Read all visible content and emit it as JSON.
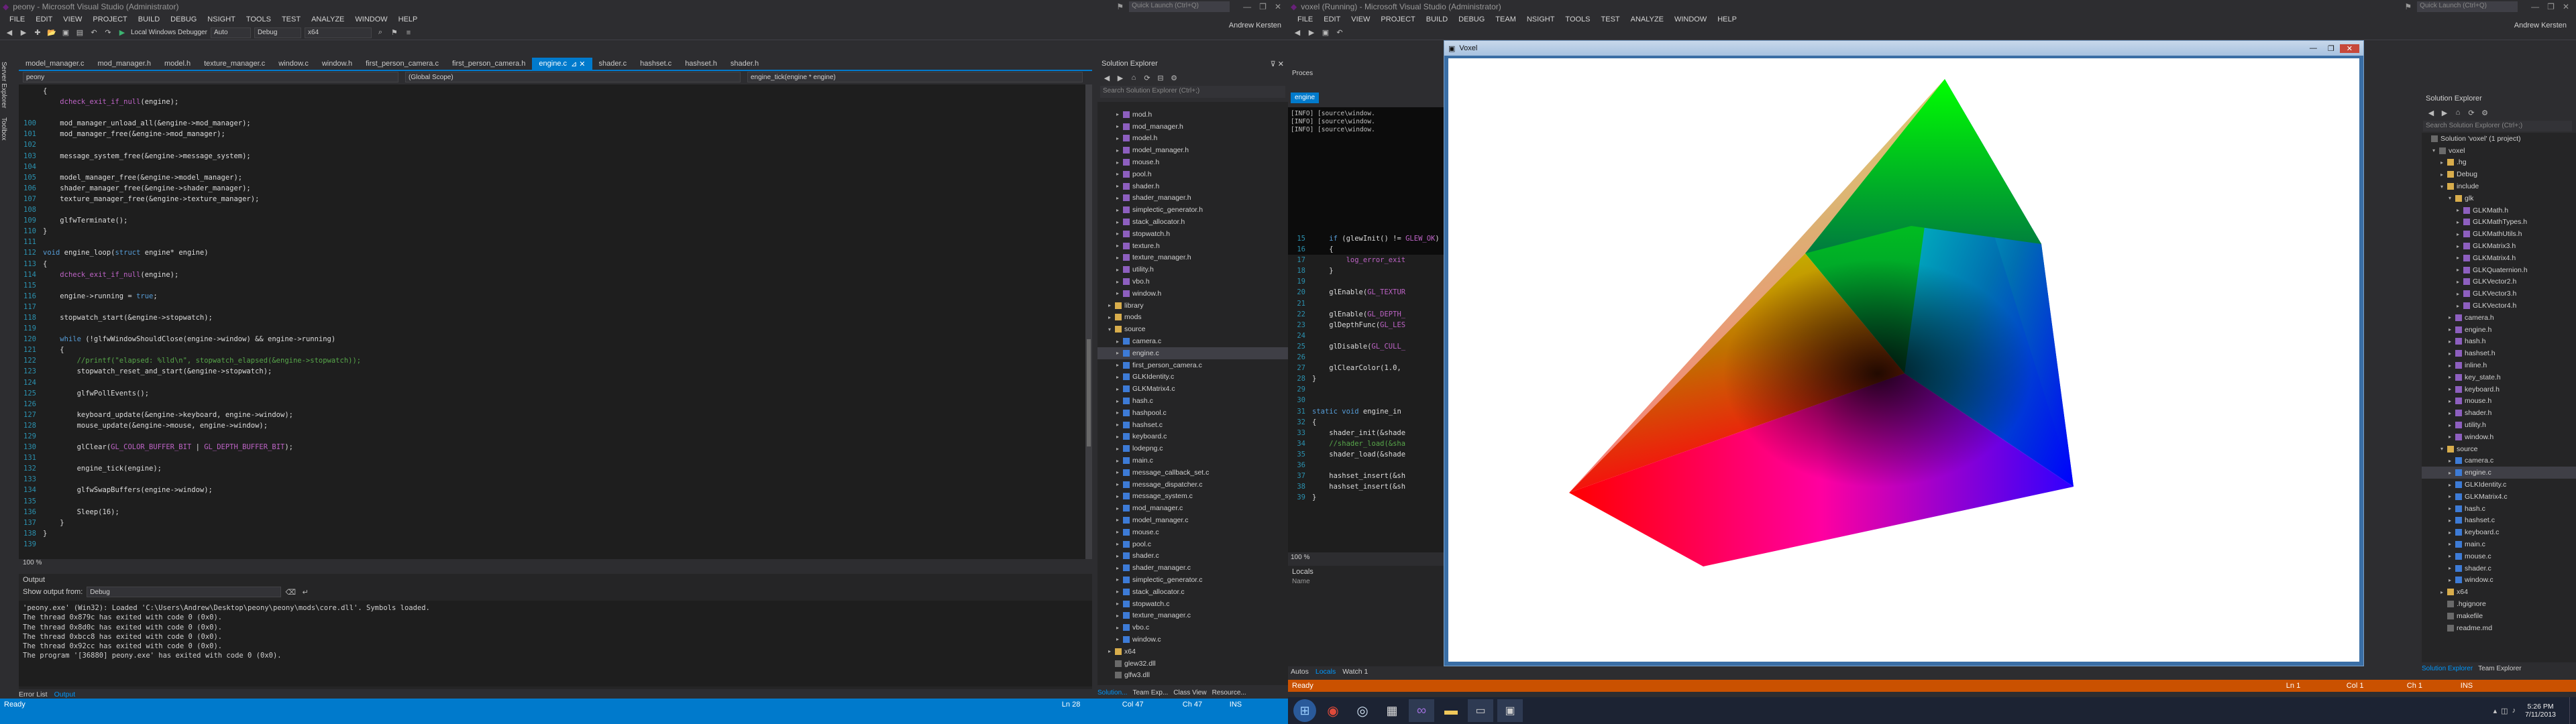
{
  "left": {
    "title": "peony - Microsoft Visual Studio (Administrator)",
    "quick_launch": "Quick Launch (Ctrl+Q)",
    "user": "Andrew Kersten",
    "menu": [
      "FILE",
      "EDIT",
      "VIEW",
      "PROJECT",
      "BUILD",
      "DEBUG",
      "NSIGHT",
      "TOOLS",
      "TEST",
      "ANALYZE",
      "WINDOW",
      "HELP"
    ],
    "toolbar": {
      "debugger": "Local Windows Debugger",
      "auto": "Auto",
      "config": "Debug",
      "platform": "x64"
    },
    "tabs": [
      "model_manager.c",
      "mod_manager.h",
      "model.h",
      "texture_manager.c",
      "window.c",
      "window.h",
      "first_person_camera.c",
      "first_person_camera.h",
      "engine.c",
      "shader.c",
      "hashset.c",
      "hashset.h",
      "shader.h"
    ],
    "nav": {
      "project": "peony",
      "scope": "(Global Scope)",
      "func": "engine_tick(engine * engine)"
    },
    "code": [
      {
        "n": "",
        "t": "{"
      },
      {
        "n": "",
        "t": "    dcheck_exit_if_null(engine);"
      },
      {
        "n": "",
        "t": ""
      },
      {
        "n": "100",
        "t": "    mod_manager_unload_all(&engine->mod_manager);"
      },
      {
        "n": "101",
        "t": "    mod_manager_free(&engine->mod_manager);"
      },
      {
        "n": "102",
        "t": ""
      },
      {
        "n": "103",
        "t": "    message_system_free(&engine->message_system);"
      },
      {
        "n": "104",
        "t": ""
      },
      {
        "n": "105",
        "t": "    model_manager_free(&engine->model_manager);"
      },
      {
        "n": "106",
        "t": "    shader_manager_free(&engine->shader_manager);"
      },
      {
        "n": "107",
        "t": "    texture_manager_free(&engine->texture_manager);"
      },
      {
        "n": "108",
        "t": ""
      },
      {
        "n": "109",
        "t": "    glfwTerminate();"
      },
      {
        "n": "110",
        "t": "}"
      },
      {
        "n": "111",
        "t": ""
      },
      {
        "n": "112",
        "t": "void engine_loop(struct engine* engine)"
      },
      {
        "n": "113",
        "t": "{"
      },
      {
        "n": "114",
        "t": "    dcheck_exit_if_null(engine);"
      },
      {
        "n": "115",
        "t": ""
      },
      {
        "n": "116",
        "t": "    engine->running = true;"
      },
      {
        "n": "117",
        "t": ""
      },
      {
        "n": "118",
        "t": "    stopwatch_start(&engine->stopwatch);"
      },
      {
        "n": "119",
        "t": ""
      },
      {
        "n": "120",
        "t": "    while (!glfwWindowShouldClose(engine->window) && engine->running)"
      },
      {
        "n": "121",
        "t": "    {"
      },
      {
        "n": "122",
        "t": "        //printf(\"elapsed: %lld\\n\", stopwatch_elapsed(&engine->stopwatch));"
      },
      {
        "n": "123",
        "t": "        stopwatch_reset_and_start(&engine->stopwatch);"
      },
      {
        "n": "124",
        "t": ""
      },
      {
        "n": "125",
        "t": "        glfwPollEvents();"
      },
      {
        "n": "126",
        "t": ""
      },
      {
        "n": "127",
        "t": "        keyboard_update(&engine->keyboard, engine->window);"
      },
      {
        "n": "128",
        "t": "        mouse_update(&engine->mouse, engine->window);"
      },
      {
        "n": "129",
        "t": ""
      },
      {
        "n": "130",
        "t": "        glClear(GL_COLOR_BUFFER_BIT | GL_DEPTH_BUFFER_BIT);"
      },
      {
        "n": "131",
        "t": ""
      },
      {
        "n": "132",
        "t": "        engine_tick(engine);"
      },
      {
        "n": "133",
        "t": ""
      },
      {
        "n": "134",
        "t": "        glfwSwapBuffers(engine->window);"
      },
      {
        "n": "135",
        "t": ""
      },
      {
        "n": "136",
        "t": "        Sleep(16);"
      },
      {
        "n": "137",
        "t": "    }"
      },
      {
        "n": "138",
        "t": "}"
      },
      {
        "n": "139",
        "t": ""
      }
    ],
    "zoom": "100 %",
    "output": {
      "title": "Output",
      "show_from_label": "Show output from:",
      "show_from_value": "Debug",
      "lines": [
        "'peony.exe' (Win32): Loaded 'C:\\Users\\Andrew\\Desktop\\peony\\peony\\mods\\core.dll'. Symbols loaded.",
        "The thread 0x879c has exited with code 0 (0x0).",
        "The thread 0x8d0c has exited with code 0 (0x0).",
        "The thread 0xbcc8 has exited with code 0 (0x0).",
        "The thread 0x92cc has exited with code 0 (0x0).",
        "The program '[36880] peony.exe' has exited with code 0 (0x0)."
      ]
    },
    "bottom_tabs": [
      "Error List",
      "Output"
    ],
    "solution_explorer": {
      "title": "Solution Explorer",
      "search": "Search Solution Explorer (Ctrl+;)",
      "items": [
        {
          "d": 2,
          "k": "h",
          "t": "mod.h"
        },
        {
          "d": 2,
          "k": "h",
          "t": "mod_manager.h"
        },
        {
          "d": 2,
          "k": "h",
          "t": "model.h"
        },
        {
          "d": 2,
          "k": "h",
          "t": "model_manager.h"
        },
        {
          "d": 2,
          "k": "h",
          "t": "mouse.h"
        },
        {
          "d": 2,
          "k": "h",
          "t": "pool.h"
        },
        {
          "d": 2,
          "k": "h",
          "t": "shader.h"
        },
        {
          "d": 2,
          "k": "h",
          "t": "shader_manager.h"
        },
        {
          "d": 2,
          "k": "h",
          "t": "simplectic_generator.h"
        },
        {
          "d": 2,
          "k": "h",
          "t": "stack_allocator.h"
        },
        {
          "d": 2,
          "k": "h",
          "t": "stopwatch.h"
        },
        {
          "d": 2,
          "k": "h",
          "t": "texture.h"
        },
        {
          "d": 2,
          "k": "h",
          "t": "texture_manager.h"
        },
        {
          "d": 2,
          "k": "h",
          "t": "utility.h"
        },
        {
          "d": 2,
          "k": "h",
          "t": "vbo.h"
        },
        {
          "d": 2,
          "k": "h",
          "t": "window.h"
        },
        {
          "d": 1,
          "k": "f",
          "t": "library",
          "a": "▸"
        },
        {
          "d": 1,
          "k": "f",
          "t": "mods",
          "a": "▸"
        },
        {
          "d": 1,
          "k": "f",
          "t": "source",
          "a": "▾"
        },
        {
          "d": 2,
          "k": "c",
          "t": "camera.c"
        },
        {
          "d": 2,
          "k": "c",
          "t": "engine.c",
          "sel": true
        },
        {
          "d": 2,
          "k": "c",
          "t": "first_person_camera.c"
        },
        {
          "d": 2,
          "k": "c",
          "t": "GLKIdentity.c"
        },
        {
          "d": 2,
          "k": "c",
          "t": "GLKMatrix4.c"
        },
        {
          "d": 2,
          "k": "c",
          "t": "hash.c"
        },
        {
          "d": 2,
          "k": "c",
          "t": "hashpool.c"
        },
        {
          "d": 2,
          "k": "c",
          "t": "hashset.c"
        },
        {
          "d": 2,
          "k": "c",
          "t": "keyboard.c"
        },
        {
          "d": 2,
          "k": "c",
          "t": "lodepng.c"
        },
        {
          "d": 2,
          "k": "c",
          "t": "main.c"
        },
        {
          "d": 2,
          "k": "c",
          "t": "message_callback_set.c"
        },
        {
          "d": 2,
          "k": "c",
          "t": "message_dispatcher.c"
        },
        {
          "d": 2,
          "k": "c",
          "t": "message_system.c"
        },
        {
          "d": 2,
          "k": "c",
          "t": "mod_manager.c"
        },
        {
          "d": 2,
          "k": "c",
          "t": "model_manager.c"
        },
        {
          "d": 2,
          "k": "c",
          "t": "mouse.c"
        },
        {
          "d": 2,
          "k": "c",
          "t": "pool.c"
        },
        {
          "d": 2,
          "k": "c",
          "t": "shader.c"
        },
        {
          "d": 2,
          "k": "c",
          "t": "shader_manager.c"
        },
        {
          "d": 2,
          "k": "c",
          "t": "simplectic_generator.c"
        },
        {
          "d": 2,
          "k": "c",
          "t": "stack_allocator.c"
        },
        {
          "d": 2,
          "k": "c",
          "t": "stopwatch.c"
        },
        {
          "d": 2,
          "k": "c",
          "t": "texture_manager.c"
        },
        {
          "d": 2,
          "k": "c",
          "t": "vbo.c"
        },
        {
          "d": 2,
          "k": "c",
          "t": "window.c"
        },
        {
          "d": 1,
          "k": "f",
          "t": "x64",
          "a": "▸"
        },
        {
          "d": 1,
          "k": "p",
          "t": "glew32.dll"
        },
        {
          "d": 1,
          "k": "p",
          "t": "glfw3.dll"
        }
      ],
      "bottom_tabs": [
        "Solution...",
        "Team Exp...",
        "Class View",
        "Resource..."
      ]
    },
    "status": {
      "text": "Ready",
      "ln": "Ln 28",
      "col": "Col 47",
      "ch": "Ch 47",
      "ins": "INS"
    },
    "side_tabs": [
      "Server Explorer",
      "Toolbox"
    ]
  },
  "right": {
    "title": "voxel (Running) - Microsoft Visual Studio (Administrator)",
    "quick_launch": "Quick Launch (Ctrl+Q)",
    "user": "Andrew Kersten",
    "menu": [
      "FILE",
      "EDIT",
      "VIEW",
      "PROJECT",
      "BUILD",
      "DEBUG",
      "TEAM",
      "NSIGHT",
      "TOOLS",
      "TEST",
      "ANALYZE",
      "WINDOW",
      "HELP"
    ],
    "proc_label": "Proces",
    "file_tab": "engine",
    "zoom": "100 %",
    "code": [
      {
        "n": "15",
        "t": "    if (glewInit() != GLEW_OK)"
      },
      {
        "n": "16",
        "t": "    {"
      },
      {
        "n": "17",
        "t": "        log_error_exit"
      },
      {
        "n": "18",
        "t": "    }"
      },
      {
        "n": "19",
        "t": ""
      },
      {
        "n": "20",
        "t": "    glEnable(GL_TEXTUR"
      },
      {
        "n": "21",
        "t": ""
      },
      {
        "n": "22",
        "t": "    glEnable(GL_DEPTH_"
      },
      {
        "n": "23",
        "t": "    glDepthFunc(GL_LES"
      },
      {
        "n": "24",
        "t": ""
      },
      {
        "n": "25",
        "t": "    glDisable(GL_CULL_"
      },
      {
        "n": "26",
        "t": ""
      },
      {
        "n": "27",
        "t": "    glClearColor(1.0,"
      },
      {
        "n": "28",
        "t": "}"
      },
      {
        "n": "29",
        "t": ""
      },
      {
        "n": "30",
        "t": ""
      },
      {
        "n": "31",
        "t": "static void engine_in"
      },
      {
        "n": "32",
        "t": "{"
      },
      {
        "n": "33",
        "t": "    shader_init(&shade"
      },
      {
        "n": "34",
        "t": "    //shader_load(&sha"
      },
      {
        "n": "35",
        "t": "    shader_load(&shade"
      },
      {
        "n": "36",
        "t": ""
      },
      {
        "n": "37",
        "t": "    hashset_insert(&sh"
      },
      {
        "n": "38",
        "t": "    hashset_insert(&sh"
      },
      {
        "n": "39",
        "t": "}"
      }
    ],
    "console_lines": [
      "[INFO] [source\\window.",
      "[INFO] [source\\window.",
      "[INFO] [source\\window."
    ],
    "locals": {
      "title": "Locals",
      "name_col": "Name"
    },
    "bottom_tabs": [
      "Autos",
      "Locals",
      "Watch 1"
    ],
    "voxel_window_title": "Voxel",
    "solution_explorer": {
      "title": "Solution Explorer",
      "search": "Search Solution Explorer (Ctrl+;)",
      "items": [
        {
          "d": 0,
          "k": "p",
          "t": "Solution 'voxel' (1 project)"
        },
        {
          "d": 1,
          "k": "p",
          "t": "voxel",
          "a": "▾"
        },
        {
          "d": 2,
          "k": "f",
          "t": ".hg",
          "a": "▸"
        },
        {
          "d": 2,
          "k": "f",
          "t": "Debug",
          "a": "▸"
        },
        {
          "d": 2,
          "k": "f",
          "t": "include",
          "a": "▾"
        },
        {
          "d": 3,
          "k": "f",
          "t": "glk",
          "a": "▾"
        },
        {
          "d": 4,
          "k": "h",
          "t": "GLKMath.h"
        },
        {
          "d": 4,
          "k": "h",
          "t": "GLKMathTypes.h"
        },
        {
          "d": 4,
          "k": "h",
          "t": "GLKMathUtils.h"
        },
        {
          "d": 4,
          "k": "h",
          "t": "GLKMatrix3.h"
        },
        {
          "d": 4,
          "k": "h",
          "t": "GLKMatrix4.h"
        },
        {
          "d": 4,
          "k": "h",
          "t": "GLKQuaternion.h"
        },
        {
          "d": 4,
          "k": "h",
          "t": "GLKVector2.h"
        },
        {
          "d": 4,
          "k": "h",
          "t": "GLKVector3.h"
        },
        {
          "d": 4,
          "k": "h",
          "t": "GLKVector4.h"
        },
        {
          "d": 3,
          "k": "h",
          "t": "camera.h"
        },
        {
          "d": 3,
          "k": "h",
          "t": "engine.h"
        },
        {
          "d": 3,
          "k": "h",
          "t": "hash.h"
        },
        {
          "d": 3,
          "k": "h",
          "t": "hashset.h"
        },
        {
          "d": 3,
          "k": "h",
          "t": "inline.h"
        },
        {
          "d": 3,
          "k": "h",
          "t": "key_state.h"
        },
        {
          "d": 3,
          "k": "h",
          "t": "keyboard.h"
        },
        {
          "d": 3,
          "k": "h",
          "t": "mouse.h"
        },
        {
          "d": 3,
          "k": "h",
          "t": "shader.h"
        },
        {
          "d": 3,
          "k": "h",
          "t": "utility.h"
        },
        {
          "d": 3,
          "k": "h",
          "t": "window.h"
        },
        {
          "d": 2,
          "k": "f",
          "t": "source",
          "a": "▾"
        },
        {
          "d": 3,
          "k": "c",
          "t": "camera.c"
        },
        {
          "d": 3,
          "k": "c",
          "t": "engine.c",
          "sel": true
        },
        {
          "d": 3,
          "k": "c",
          "t": "GLKIdentity.c"
        },
        {
          "d": 3,
          "k": "c",
          "t": "GLKMatrix4.c"
        },
        {
          "d": 3,
          "k": "c",
          "t": "hash.c"
        },
        {
          "d": 3,
          "k": "c",
          "t": "hashset.c"
        },
        {
          "d": 3,
          "k": "c",
          "t": "keyboard.c"
        },
        {
          "d": 3,
          "k": "c",
          "t": "main.c"
        },
        {
          "d": 3,
          "k": "c",
          "t": "mouse.c"
        },
        {
          "d": 3,
          "k": "c",
          "t": "shader.c"
        },
        {
          "d": 3,
          "k": "c",
          "t": "window.c"
        },
        {
          "d": 2,
          "k": "f",
          "t": "x64",
          "a": "▸"
        },
        {
          "d": 2,
          "k": "p",
          "t": ".hgignore"
        },
        {
          "d": 2,
          "k": "p",
          "t": "makefile"
        },
        {
          "d": 2,
          "k": "p",
          "t": "readme.md"
        }
      ],
      "bottom_tabs": [
        "Solution Explorer",
        "Team Explorer"
      ]
    },
    "status": {
      "text": "Ready",
      "ln": "Ln 1",
      "col": "Col 1",
      "ch": "Ch 1",
      "ins": "INS"
    }
  },
  "taskbar": {
    "time": "5:26 PM",
    "date": "7/11/2013"
  },
  "colors": {
    "accent": "#007acc",
    "debug_status": "#ca5100",
    "bg": "#2d2d30",
    "editor": "#1e1e1e"
  }
}
